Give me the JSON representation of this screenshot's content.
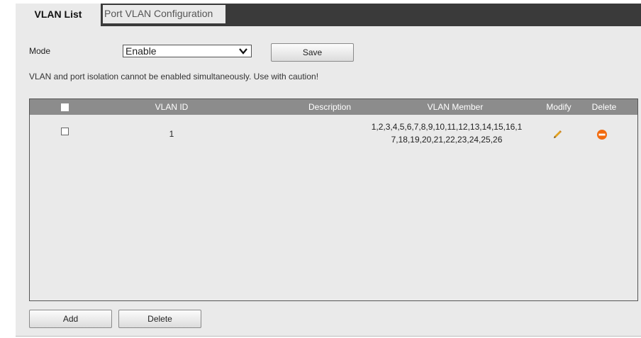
{
  "tabs": {
    "vlan_list": "VLAN List",
    "port_vlan": "Port VLAN Configuration"
  },
  "mode": {
    "label": "Mode",
    "selected": "Enable"
  },
  "buttons": {
    "save": "Save",
    "add": "Add",
    "delete": "Delete"
  },
  "warning": "VLAN and port isolation cannot be enabled simultaneously. Use with caution!",
  "table": {
    "headers": {
      "vlan_id": "VLAN ID",
      "description": "Description",
      "vlan_member": "VLAN Member",
      "modify": "Modify",
      "delete": "Delete"
    },
    "rows": [
      {
        "vlan_id": "1",
        "description": "",
        "member_line1": "1,2,3,4,5,6,7,8,9,10,11,12,13,14,15,16,1",
        "member_line2": "7,18,19,20,21,22,23,24,25,26"
      }
    ]
  },
  "icons": {
    "modify": "pencil-icon",
    "delete": "minus-circle-icon",
    "dropdown": "chevron-down-icon"
  },
  "colors": {
    "tab_bar": "#3a3a3a",
    "panel_bg": "#eaeaea",
    "table_header": "#8c8c8c",
    "delete_icon": "#f26b0f",
    "modify_icon": "#e0a020"
  }
}
